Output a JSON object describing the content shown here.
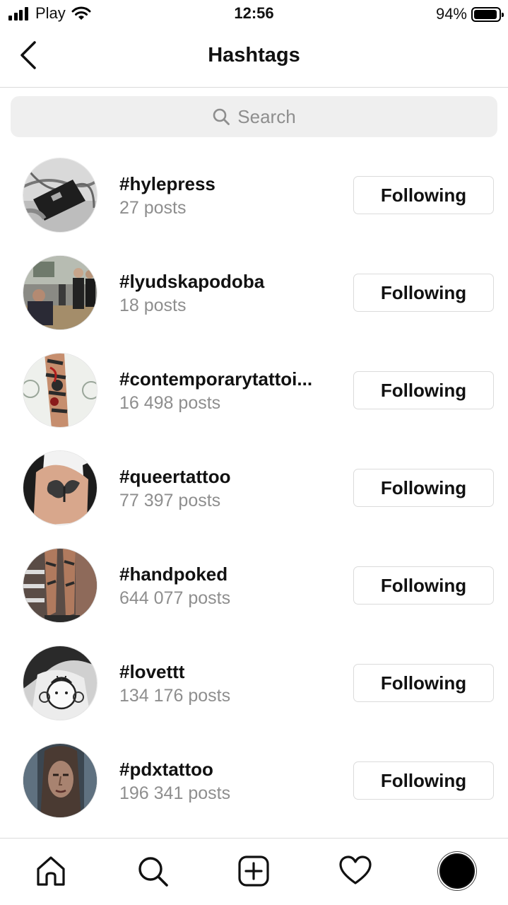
{
  "status_bar": {
    "carrier": "Play",
    "time": "12:56",
    "battery_percent": "94%",
    "battery_level": 0.94,
    "signal_icon": "cellular-signal-icon",
    "wifi_icon": "wifi-icon"
  },
  "header": {
    "title": "Hashtags",
    "back_icon": "chevron-left-icon"
  },
  "search": {
    "placeholder": "Search",
    "icon": "search-icon"
  },
  "hashtags": [
    {
      "name": "#hylepress",
      "posts": "27 posts",
      "button": "Following"
    },
    {
      "name": "#lyudskapodoba",
      "posts": "18 posts",
      "button": "Following"
    },
    {
      "name": "#contemporarytattoi...",
      "posts": "16 498 posts",
      "button": "Following"
    },
    {
      "name": "#queertattoo",
      "posts": "77 397 posts",
      "button": "Following"
    },
    {
      "name": "#handpoked",
      "posts": "644 077 posts",
      "button": "Following"
    },
    {
      "name": "#lovettt",
      "posts": "134 176 posts",
      "button": "Following"
    },
    {
      "name": "#pdxtattoo",
      "posts": "196 341 posts",
      "button": "Following"
    }
  ],
  "tab_bar": {
    "items": [
      "home-icon",
      "search-icon",
      "new-post-icon",
      "heart-icon",
      "profile-avatar"
    ]
  },
  "colors": {
    "secondary_text": "#8e8e8e",
    "border": "#dbdbdb",
    "search_bg": "#efefef"
  }
}
